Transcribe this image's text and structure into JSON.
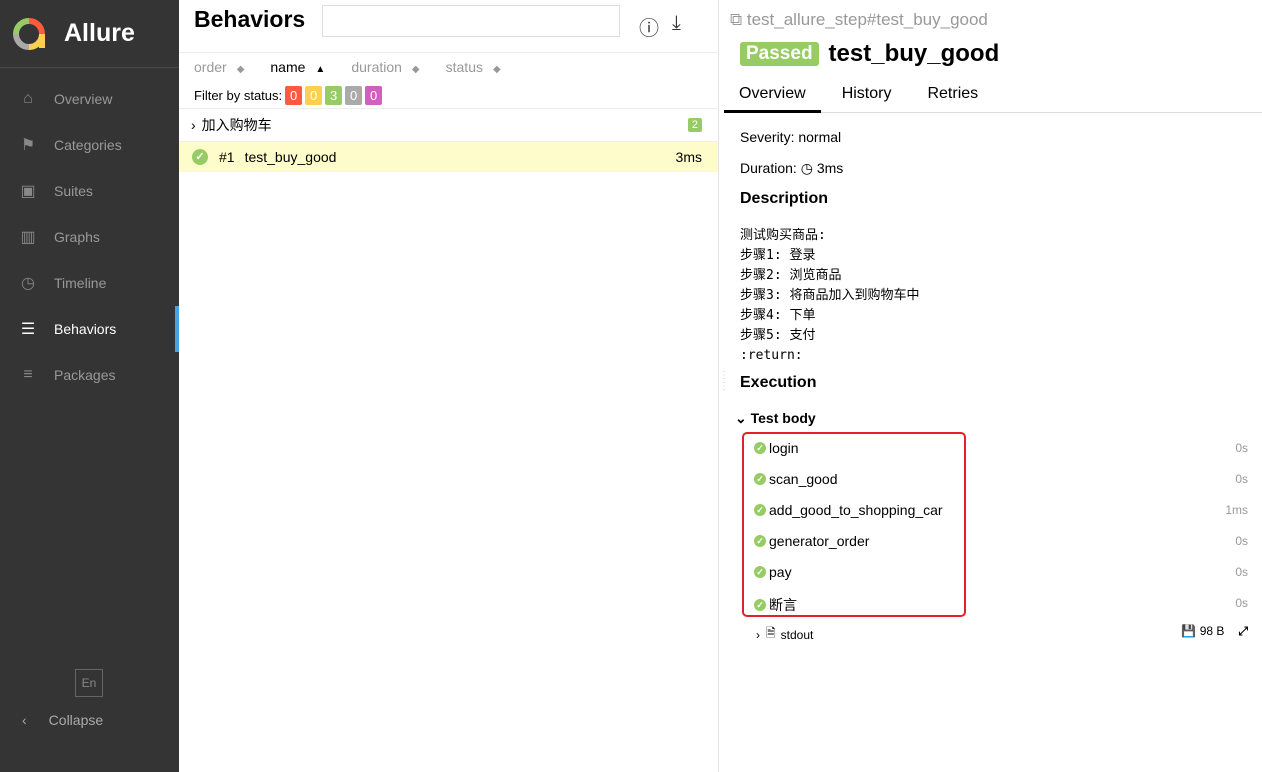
{
  "app": {
    "name": "Allure",
    "lang": "En",
    "collapse": "Collapse"
  },
  "sidebar": {
    "items": [
      {
        "label": "Overview",
        "icon": "home-icon",
        "glyph": "⌂"
      },
      {
        "label": "Categories",
        "icon": "flag-icon",
        "glyph": "⚑"
      },
      {
        "label": "Suites",
        "icon": "briefcase-icon",
        "glyph": "▣"
      },
      {
        "label": "Graphs",
        "icon": "bar-chart-icon",
        "glyph": "▥"
      },
      {
        "label": "Timeline",
        "icon": "clock-icon",
        "glyph": "◷"
      },
      {
        "label": "Behaviors",
        "icon": "list-icon",
        "glyph": "☰",
        "active": true
      },
      {
        "label": "Packages",
        "icon": "align-left-icon",
        "glyph": "≡"
      }
    ]
  },
  "behaviors": {
    "title": "Behaviors",
    "search_value": "",
    "sorters": [
      {
        "label": "order"
      },
      {
        "label": "name",
        "active": true
      },
      {
        "label": "duration"
      },
      {
        "label": "status"
      }
    ],
    "filter_label": "Filter by status:",
    "status_counts": [
      {
        "count": "0",
        "color": "#fd5a3e"
      },
      {
        "count": "0",
        "color": "#ffd050"
      },
      {
        "count": "3",
        "color": "#97cc64"
      },
      {
        "count": "0",
        "color": "#aaaaaa"
      },
      {
        "count": "0",
        "color": "#d35ebe"
      }
    ],
    "group": {
      "name": "加入购物车",
      "count": "2"
    },
    "tests": [
      {
        "index": "#1",
        "name": "test_buy_good",
        "duration": "3ms",
        "status": "passed"
      }
    ]
  },
  "detail": {
    "breadcrumb": "test_allure_step#test_buy_good",
    "status": "Passed",
    "title": "test_buy_good",
    "tabs": [
      "Overview",
      "History",
      "Retries"
    ],
    "severity": "Severity: normal",
    "duration_label": "Duration:",
    "duration": "3ms",
    "description_title": "Description",
    "description": "测试购买商品:\n步骤1: 登录\n步骤2: 浏览商品\n步骤3: 将商品加入到购物车中\n步骤4: 下单\n步骤5: 支付\n:return:",
    "execution_title": "Execution",
    "test_body": "Test body",
    "steps": [
      {
        "name": "login",
        "duration": "0s"
      },
      {
        "name": "scan_good",
        "duration": "0s"
      },
      {
        "name": "add_good_to_shopping_car",
        "duration": "1ms"
      },
      {
        "name": "generator_order",
        "duration": "0s"
      },
      {
        "name": "pay",
        "duration": "0s"
      },
      {
        "name": "断言",
        "duration": "0s"
      }
    ],
    "attachment": {
      "name": "stdout",
      "size": "98 B"
    },
    "colors": {
      "passed": "#97cc64",
      "highlight": "#e0202a"
    }
  }
}
